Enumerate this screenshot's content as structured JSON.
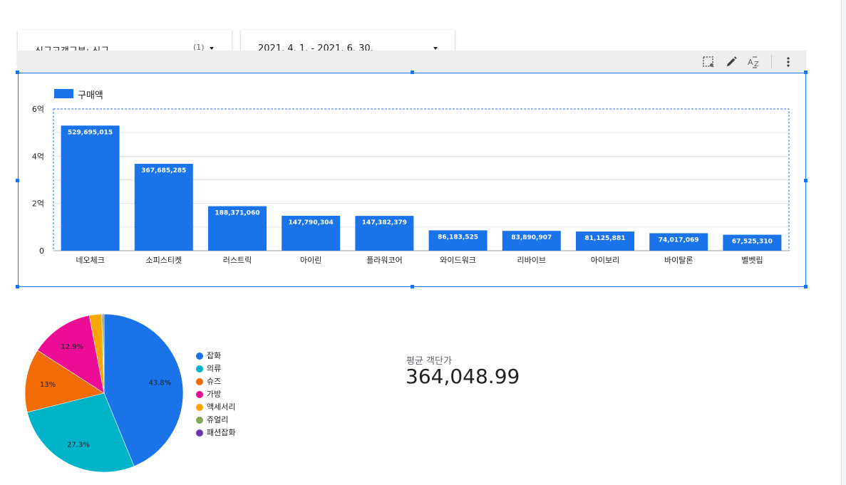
{
  "filters": {
    "segment": {
      "label": "신규고객구분: 신규",
      "count": "(1)"
    },
    "date_range": {
      "label": "2021. 4. 1. - 2021. 6. 30."
    }
  },
  "toolbar": {
    "icons": [
      "select-area-icon",
      "edit-pencil-icon",
      "sort-az-icon",
      "more-vert-icon"
    ]
  },
  "colors": {
    "accent": "#1a73e8",
    "bar": "#1a73e8"
  },
  "chart_data": [
    {
      "type": "bar",
      "categories": [
        "네오체크",
        "소피스티켓",
        "러스트릭",
        "아이린",
        "플라워코어",
        "와이드워크",
        "리바이브",
        "아이보리",
        "바이탈론",
        "벨벳립"
      ],
      "series": [
        {
          "name": "구매액",
          "values": [
            529695015,
            367685285,
            188371060,
            147790304,
            147382379,
            86183525,
            83890907,
            81125881,
            74017069,
            67525310
          ]
        }
      ],
      "data_labels": [
        "529,695,015",
        "367,685,285",
        "188,371,060",
        "147,790,304",
        "147,382,379",
        "86,183,525",
        "83,890,907",
        "81,125,881",
        "74,017,069",
        "67,525,310"
      ],
      "y_ticks": [
        {
          "value": 0,
          "label": "0"
        },
        {
          "value": 200000000,
          "label": "2억"
        },
        {
          "value": 400000000,
          "label": "4억"
        },
        {
          "value": 600000000,
          "label": "6억"
        }
      ],
      "ylim": [
        0,
        600000000
      ],
      "grid": true,
      "legend": "top-left",
      "color": "#1a73e8"
    },
    {
      "type": "pie",
      "slices": [
        {
          "label": "잡화",
          "value": 43.8,
          "display": "43.8%",
          "color": "#1a73e8"
        },
        {
          "label": "의류",
          "value": 27.3,
          "display": "27.3%",
          "color": "#00b3c8"
        },
        {
          "label": "슈즈",
          "value": 13.0,
          "display": "13%",
          "color": "#f16b06"
        },
        {
          "label": "가방",
          "value": 12.9,
          "display": "12.9%",
          "color": "#ec0c96"
        },
        {
          "label": "액세서리",
          "value": 2.5,
          "display": "",
          "color": "#f9a602"
        },
        {
          "label": "쥬얼리",
          "value": 0.3,
          "display": "",
          "color": "#7fa84e"
        },
        {
          "label": "패션잡화",
          "value": 0.2,
          "display": "",
          "color": "#6438b0"
        }
      ],
      "legend": "right"
    }
  ],
  "scorecard": {
    "label": "평균 객단가",
    "value": "364,048.99"
  }
}
